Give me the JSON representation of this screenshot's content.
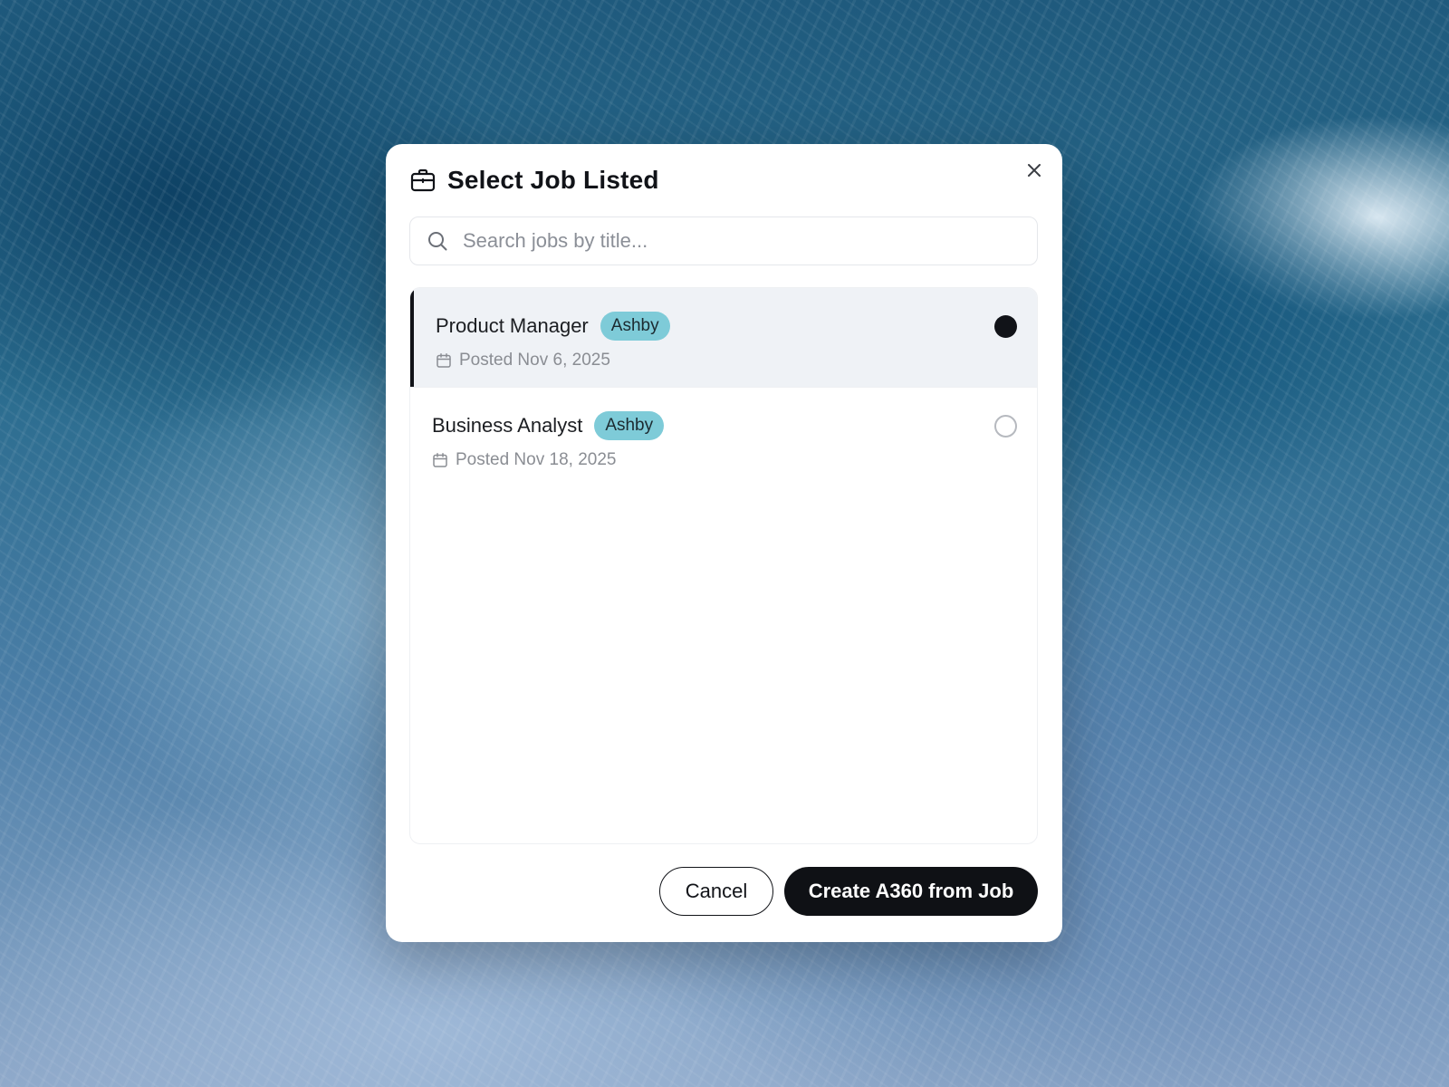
{
  "modal": {
    "title": "Select Job Listed",
    "title_icon": "briefcase-icon",
    "close_icon": "close-icon"
  },
  "search": {
    "placeholder": "Search jobs by title...",
    "value": "",
    "icon": "search-icon"
  },
  "jobs": [
    {
      "title": "Product Manager",
      "source": "Ashby",
      "posted": "Posted Nov 6, 2025",
      "selected": true
    },
    {
      "title": "Business Analyst",
      "source": "Ashby",
      "posted": "Posted Nov 18, 2025",
      "selected": false
    }
  ],
  "actions": {
    "cancel_label": "Cancel",
    "create_label": "Create A360 from Job"
  },
  "colors": {
    "badge": "#7ecbd8",
    "primary": "#0f1115",
    "selected_row": "#eff2f6"
  }
}
